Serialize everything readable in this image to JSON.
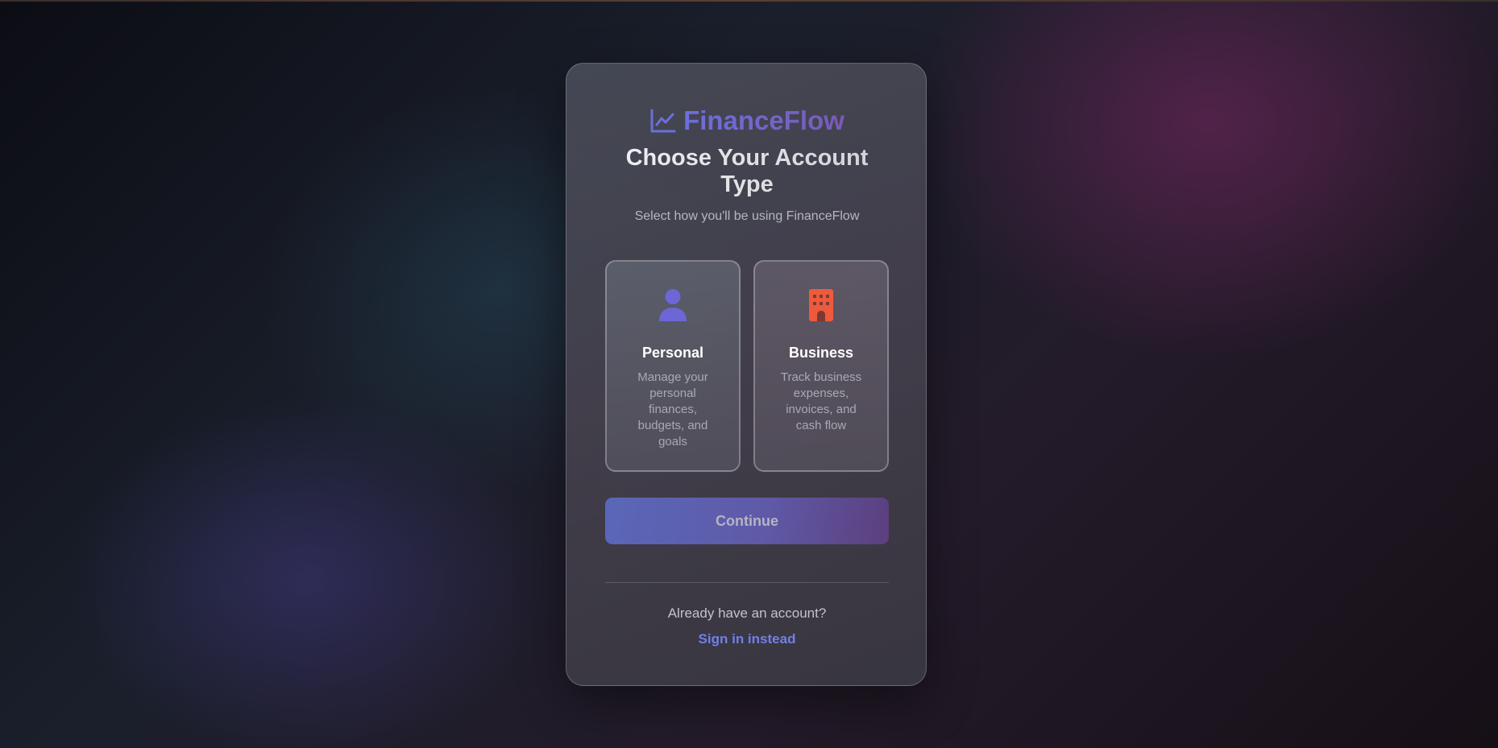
{
  "brand": {
    "name": "FinanceFlow",
    "icon": "chart-line-icon",
    "color": "#6c70dc"
  },
  "heading": {
    "title": "Choose Your Account Type",
    "subtitle": "Select how you'll be using FinanceFlow"
  },
  "options": [
    {
      "icon": "user-icon",
      "icon_color": "#6d66d6",
      "label": "Personal",
      "description": "Manage your personal finances, budgets, and goals"
    },
    {
      "icon": "building-icon",
      "icon_color": "#ef5a3c",
      "label": "Business",
      "description": "Track business expenses, invoices, and cash flow"
    }
  ],
  "actions": {
    "continue_label": "Continue",
    "already_text": "Already have an account?",
    "signin_label": "Sign in instead"
  }
}
